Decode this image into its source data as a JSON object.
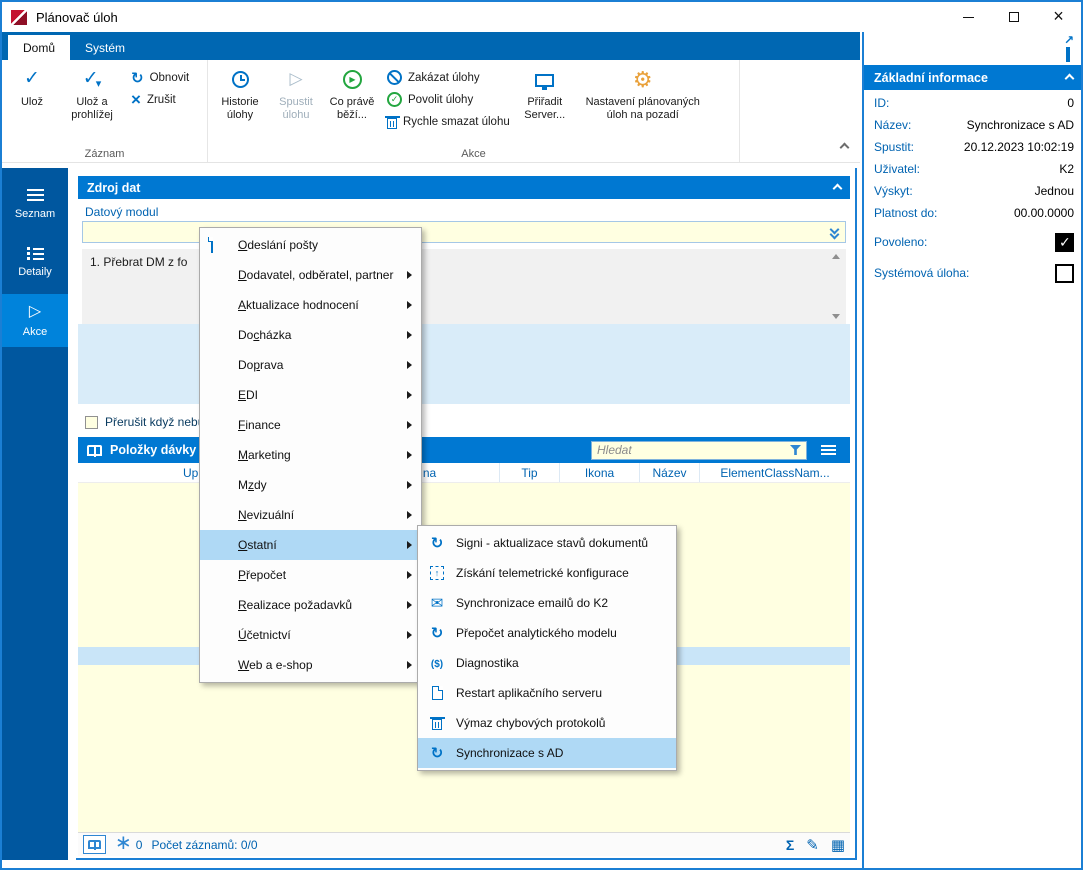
{
  "window": {
    "title": "Plánovač úloh"
  },
  "tabs": {
    "items": [
      {
        "label": "Domů",
        "state": "active"
      },
      {
        "label": "Systém",
        "state": "normal"
      }
    ]
  },
  "ribbon": {
    "save": "Ulož",
    "save_and_view": "Ulož a prohlížej",
    "refresh": "Obnovit",
    "cancel": "Zrušit",
    "group_record": "Záznam",
    "history": "Historie úlohy",
    "run": "Spustit úlohu",
    "running": "Co právě běží...",
    "disable": "Zakázat úlohy",
    "enable": "Povolit úlohy",
    "quick_delete": "Rychle smazat úlohu",
    "assign_server": "Přiřadit Server...",
    "background_settings": "Nastavení plánovaných úloh na pozadí",
    "group_actions": "Akce"
  },
  "sidebar": {
    "items": [
      {
        "label": "Seznam",
        "state": "normal"
      },
      {
        "label": "Detaily",
        "state": "normal"
      },
      {
        "label": "Akce",
        "state": "active"
      }
    ]
  },
  "data_source": {
    "title": "Zdroj dat",
    "module_label": "Datový modul",
    "module_value": "",
    "list_item": "1. Přebrat DM z fo",
    "interrupt_label": "Přerušit když nebu"
  },
  "batch": {
    "title": "Položky dávky",
    "search_placeholder": "Hledat",
    "columns": [
      "Uprav...",
      "Skupina",
      "Tip",
      "Ikona",
      "Název",
      "ElementClassNam..."
    ],
    "counter": "0",
    "record_count": "Počet záznamů: 0/0"
  },
  "context_menu": {
    "items": [
      {
        "label": "Odeslání pošty",
        "accel": 0,
        "icon": "document"
      },
      {
        "label": "Dodavatel, odběratel, partner",
        "accel": 0,
        "submenu": true
      },
      {
        "label": "Aktualizace hodnocení",
        "accel": 0,
        "submenu": true
      },
      {
        "label": "Docházka",
        "accel": 2,
        "submenu": true
      },
      {
        "label": "Doprava",
        "accel": 2,
        "submenu": true
      },
      {
        "label": "EDI",
        "accel": 0,
        "submenu": true
      },
      {
        "label": "Finance",
        "accel": 0,
        "submenu": true
      },
      {
        "label": "Marketing",
        "accel": 0,
        "submenu": true
      },
      {
        "label": "Mzdy",
        "accel": 1,
        "submenu": true
      },
      {
        "label": "Nevizuální",
        "accel": 0,
        "submenu": true
      },
      {
        "label": "Ostatní",
        "accel": 0,
        "submenu": true,
        "state": "highlighted"
      },
      {
        "label": "Přepočet",
        "accel": 0,
        "submenu": true
      },
      {
        "label": "Realizace požadavků",
        "accel": 0,
        "submenu": true
      },
      {
        "label": "Účetnictví",
        "accel": 0,
        "submenu": true
      },
      {
        "label": "Web a e-shop",
        "accel": 0,
        "submenu": true
      }
    ]
  },
  "submenu": {
    "items": [
      {
        "label": "Signi - aktualizace stavů dokumentů",
        "icon": "refresh"
      },
      {
        "label": "Získání telemetrické konfigurace",
        "icon": "import"
      },
      {
        "label": "Synchronizace emailů do K2",
        "icon": "mail"
      },
      {
        "label": "Přepočet analytického modelu",
        "icon": "refresh"
      },
      {
        "label": "Diagnostika",
        "icon": "currency-refresh"
      },
      {
        "label": "Restart aplikačního serveru",
        "icon": "document"
      },
      {
        "label": "Výmaz chybových protokolů",
        "icon": "delete"
      },
      {
        "label": "Synchronizace s AD",
        "icon": "refresh",
        "state": "highlighted"
      }
    ]
  },
  "info_panel": {
    "title": "Základní informace",
    "rows": [
      {
        "label": "ID:",
        "value": "0"
      },
      {
        "label": "Název:",
        "value": "Synchronizace s AD"
      },
      {
        "label": "Spustit:",
        "value": "20.12.2023 10:02:19"
      },
      {
        "label": "Uživatel:",
        "value": "K2"
      },
      {
        "label": "Výskyt:",
        "value": "Jednou"
      },
      {
        "label": "Platnost do:",
        "value": "00.00.0000"
      }
    ],
    "checks": [
      {
        "label": "Povoleno:",
        "state": "checked"
      },
      {
        "label": "Systémová úloha:",
        "state": "unchecked"
      }
    ]
  },
  "icons": {
    "save-icon": "check",
    "refresh-icon": "circular-arrow",
    "cancel-icon": "x",
    "history-icon": "clock",
    "run-icon": "play",
    "running-icon": "green-play-circle",
    "disable-icon": "crossed-circle",
    "enable-icon": "green-check-circle",
    "delete-icon": "trash",
    "assign-server-icon": "monitor",
    "settings-icon": "gear",
    "book-icon": "open-book",
    "filter-icon": "funnel",
    "menu-icon": "hamburger",
    "sum-icon": "sigma",
    "edit-icon": "pencil",
    "grid-icon": "grid",
    "document-icon": "page",
    "mail-icon": "envelope",
    "import-icon": "dashed-box-arrow",
    "external-icon": "open-in-window",
    "dropdown-icon": "double-chevron-down"
  },
  "colors": {
    "accent_blue": "#0078D2",
    "dark_blue": "#00579F",
    "tab_blue": "#0067B2",
    "text_blue": "#0063B1",
    "field_yellow": "#FFFFE1",
    "panel_light_blue": "#D9ECF9",
    "highlight_blue": "#AFD9F5",
    "green": "#23A63F",
    "gear_orange": "#E9A13B"
  }
}
